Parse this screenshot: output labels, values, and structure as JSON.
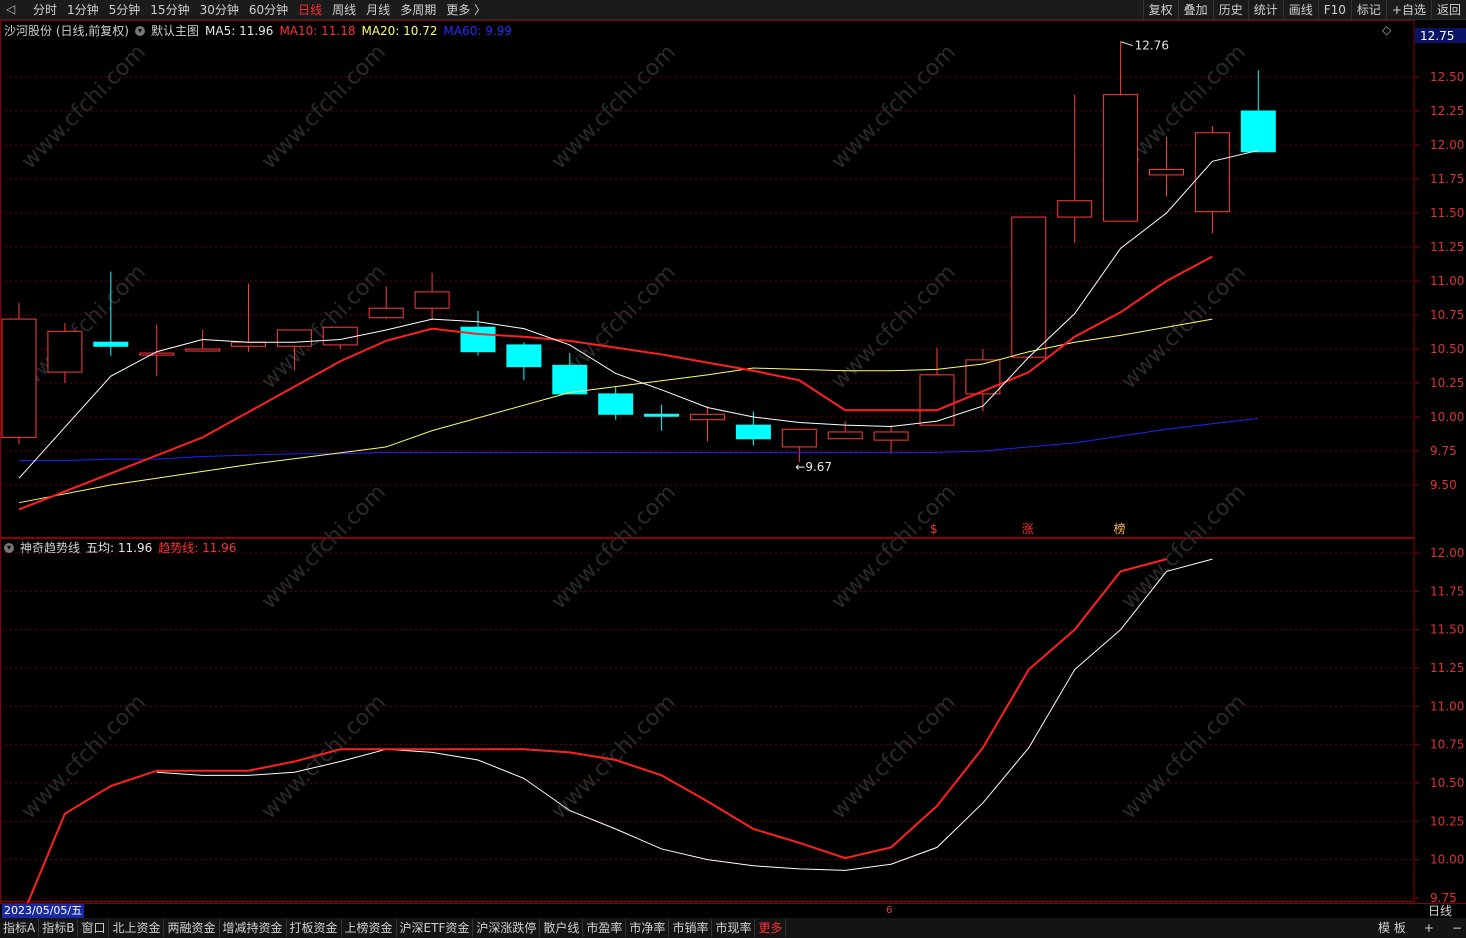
{
  "toolbar": {
    "periods": [
      "分时",
      "1分钟",
      "5分钟",
      "15分钟",
      "30分钟",
      "60分钟",
      "日线",
      "周线",
      "月线",
      "多周期",
      "更多 〉"
    ],
    "active_period": "日线",
    "tools": [
      "复权",
      "叠加",
      "历史",
      "统计",
      "画线",
      "F10",
      "标记",
      "+自选",
      "返回"
    ]
  },
  "main_panel": {
    "stock": "沙河股份 (日线,前复权)",
    "template": "默认主图",
    "ma5": "MA5: 11.96",
    "ma10": "MA10: 11.18",
    "ma20": "MA20: 10.72",
    "ma60": "MA60: 9.99",
    "price_tag": "12.75",
    "high_label": "12.76",
    "low_label": "9.67",
    "markers": [
      "$",
      "涨",
      "榜"
    ],
    "y_ticks": [
      "12.50",
      "12.25",
      "12.00",
      "11.75",
      "11.50",
      "11.25",
      "11.00",
      "10.75",
      "10.50",
      "10.25",
      "10.00",
      "9.75",
      "9.50"
    ]
  },
  "sub_panel": {
    "indicator": "神奇趋势线",
    "five_avg": "五均: 11.96",
    "trend": "趋势线: 11.96",
    "y_ticks": [
      "12.00",
      "11.75",
      "11.50",
      "11.25",
      "11.00",
      "10.75",
      "10.50",
      "10.25",
      "10.00",
      "9.75"
    ]
  },
  "watermark": "www.cfchi.com",
  "colors": {
    "up": "#ff3b3b",
    "down": "#00ffff",
    "ma5": "#ffffff",
    "ma10": "#ff2020",
    "ma20": "#ffff66",
    "ma60": "#2020ff",
    "axis": "#8b0000"
  },
  "chart_data": {
    "type": "candlestick",
    "candles": [
      {
        "o": 9.85,
        "c": 10.72,
        "h": 10.84,
        "l": 9.8
      },
      {
        "o": 10.33,
        "c": 10.63,
        "h": 10.69,
        "l": 10.25
      },
      {
        "o": 10.55,
        "c": 10.52,
        "h": 11.07,
        "l": 10.45
      },
      {
        "o": 10.47,
        "c": 10.47,
        "h": 10.68,
        "l": 10.3
      },
      {
        "o": 10.5,
        "c": 10.5,
        "h": 10.64,
        "l": 10.48
      },
      {
        "o": 10.52,
        "c": 10.55,
        "h": 10.98,
        "l": 10.48
      },
      {
        "o": 10.52,
        "c": 10.64,
        "h": 10.64,
        "l": 10.34
      },
      {
        "o": 10.53,
        "c": 10.66,
        "h": 10.66,
        "l": 10.5
      },
      {
        "o": 10.73,
        "c": 10.8,
        "h": 10.96,
        "l": 10.72
      },
      {
        "o": 10.8,
        "c": 10.92,
        "h": 11.06,
        "l": 10.72
      },
      {
        "o": 10.66,
        "c": 10.48,
        "h": 10.78,
        "l": 10.45
      },
      {
        "o": 10.53,
        "c": 10.37,
        "h": 10.55,
        "l": 10.27
      },
      {
        "o": 10.38,
        "c": 10.17,
        "h": 10.47,
        "l": 10.17
      },
      {
        "o": 10.17,
        "c": 10.02,
        "h": 10.22,
        "l": 9.98
      },
      {
        "o": 10.02,
        "c": 10.01,
        "h": 10.09,
        "l": 9.9
      },
      {
        "o": 9.98,
        "c": 10.02,
        "h": 10.08,
        "l": 9.82
      },
      {
        "o": 9.94,
        "c": 9.84,
        "h": 10.04,
        "l": 9.79
      },
      {
        "o": 9.78,
        "c": 9.91,
        "h": 9.91,
        "l": 9.67
      },
      {
        "o": 9.84,
        "c": 9.89,
        "h": 9.97,
        "l": 9.84
      },
      {
        "o": 9.83,
        "c": 9.89,
        "h": 9.94,
        "l": 9.73
      },
      {
        "o": 9.94,
        "c": 10.31,
        "h": 10.51,
        "l": 9.94
      },
      {
        "o": 10.17,
        "c": 10.42,
        "h": 10.5,
        "l": 10.04
      },
      {
        "o": 10.44,
        "c": 11.47,
        "h": 11.47,
        "l": 10.44
      },
      {
        "o": 11.47,
        "c": 11.59,
        "h": 12.37,
        "l": 11.28
      },
      {
        "o": 11.44,
        "c": 12.37,
        "h": 12.76,
        "l": 11.44
      },
      {
        "o": 11.78,
        "c": 11.82,
        "h": 12.06,
        "l": 11.62
      },
      {
        "o": 11.51,
        "c": 12.09,
        "h": 12.14,
        "l": 11.35
      },
      {
        "o": 12.25,
        "c": 11.95,
        "h": 12.55,
        "l": 11.95
      }
    ],
    "ma5": [
      9.55,
      null,
      10.3,
      10.48,
      10.57,
      10.55,
      10.55,
      10.57,
      10.64,
      10.72,
      10.7,
      10.65,
      10.53,
      10.32,
      10.2,
      10.07,
      10.0,
      9.96,
      9.94,
      9.93,
      9.97,
      10.08,
      10.44,
      10.76,
      11.24,
      11.5,
      11.88,
      11.96
    ],
    "ma10": [
      9.32,
      null,
      null,
      null,
      9.85,
      null,
      null,
      10.41,
      10.56,
      10.65,
      10.61,
      10.59,
      10.56,
      10.51,
      10.46,
      10.4,
      10.34,
      10.27,
      10.05,
      10.05,
      10.05,
      10.19,
      10.33,
      10.59,
      10.77,
      11.0,
      11.18
    ],
    "ma20": [
      9.37,
      null,
      9.5,
      null,
      null,
      9.65,
      null,
      null,
      9.78,
      9.9,
      null,
      null,
      10.18,
      null,
      null,
      10.31,
      10.36,
      10.35,
      10.34,
      10.34,
      10.35,
      10.39,
      10.48,
      10.55,
      10.6,
      10.66,
      10.72
    ],
    "ma60": [
      9.68,
      9.68,
      9.69,
      9.69,
      9.71,
      9.72,
      9.73,
      9.73,
      9.74,
      9.74,
      9.74,
      9.74,
      9.74,
      9.74,
      9.74,
      9.74,
      9.74,
      9.74,
      9.74,
      9.74,
      9.74,
      9.75,
      9.78,
      9.81,
      9.86,
      9.91,
      9.95,
      9.99
    ],
    "sub_five": [
      null,
      null,
      null,
      10.57,
      10.55,
      10.55,
      10.57,
      10.64,
      10.72,
      10.7,
      10.65,
      10.53,
      10.32,
      10.2,
      10.07,
      10.0,
      9.96,
      9.94,
      9.93,
      9.97,
      10.08,
      10.37,
      10.73,
      11.24,
      11.5,
      11.88,
      11.96
    ],
    "sub_trend": [
      9.58,
      10.3,
      10.48,
      10.58,
      10.58,
      10.58,
      10.64,
      10.72,
      10.72,
      10.72,
      10.72,
      10.72,
      10.7,
      10.65,
      10.55,
      10.38,
      10.2,
      10.11,
      10.01,
      10.08,
      10.35,
      10.73,
      11.24,
      11.5,
      11.88,
      11.96
    ],
    "main_ylim": [
      9.25,
      12.85
    ],
    "sub_ylim": [
      9.55,
      12.1
    ]
  }
}
